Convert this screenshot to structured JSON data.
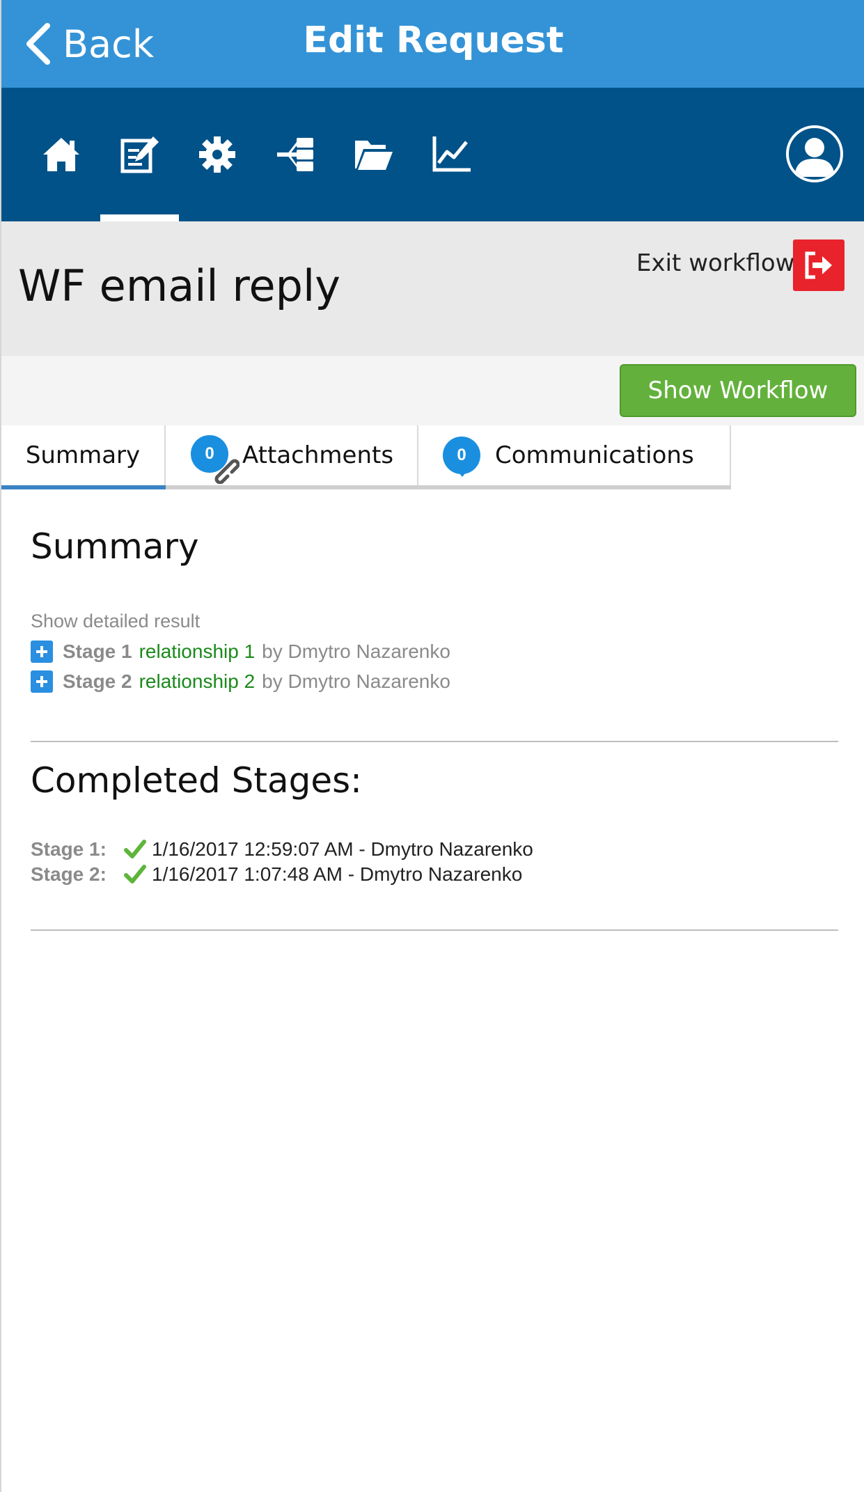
{
  "header": {
    "back_label": "Back",
    "title": "Edit Request"
  },
  "nav": {
    "icons": [
      "home-icon",
      "edit-request-icon",
      "settings-icon",
      "workflow-icon",
      "folder-icon",
      "chart-icon"
    ],
    "active_index": 1,
    "avatar_icon": "user-icon"
  },
  "request": {
    "title": "WF email reply",
    "exit_label": "Exit workflow",
    "show_workflow_label": "Show Workflow"
  },
  "tabs": [
    {
      "label": "Summary",
      "badge": null,
      "active": true
    },
    {
      "label": "Attachments",
      "badge": "0",
      "active": false
    },
    {
      "label": "Communications",
      "badge": "0",
      "active": false
    }
  ],
  "summary": {
    "heading": "Summary",
    "show_detailed_label": "Show detailed result",
    "stages": [
      {
        "stage": "Stage 1",
        "relationship": "relationship 1",
        "by": "by Dmytro Nazarenko"
      },
      {
        "stage": "Stage 2",
        "relationship": "relationship 2",
        "by": "by Dmytro Nazarenko"
      }
    ]
  },
  "completed": {
    "heading": "Completed Stages:",
    "items": [
      {
        "label": "Stage 1:",
        "text": "1/16/2017 12:59:07 AM - Dmytro Nazarenko"
      },
      {
        "label": "Stage 2:",
        "text": "1/16/2017 1:07:48 AM - Dmytro Nazarenko"
      }
    ]
  },
  "colors": {
    "header_blue": "#3493d6",
    "nav_blue": "#005289",
    "exit_red": "#e8232b",
    "workflow_green": "#63b13c",
    "relationship_green": "#1a8a1a",
    "badge_blue": "#1a8fe0"
  }
}
